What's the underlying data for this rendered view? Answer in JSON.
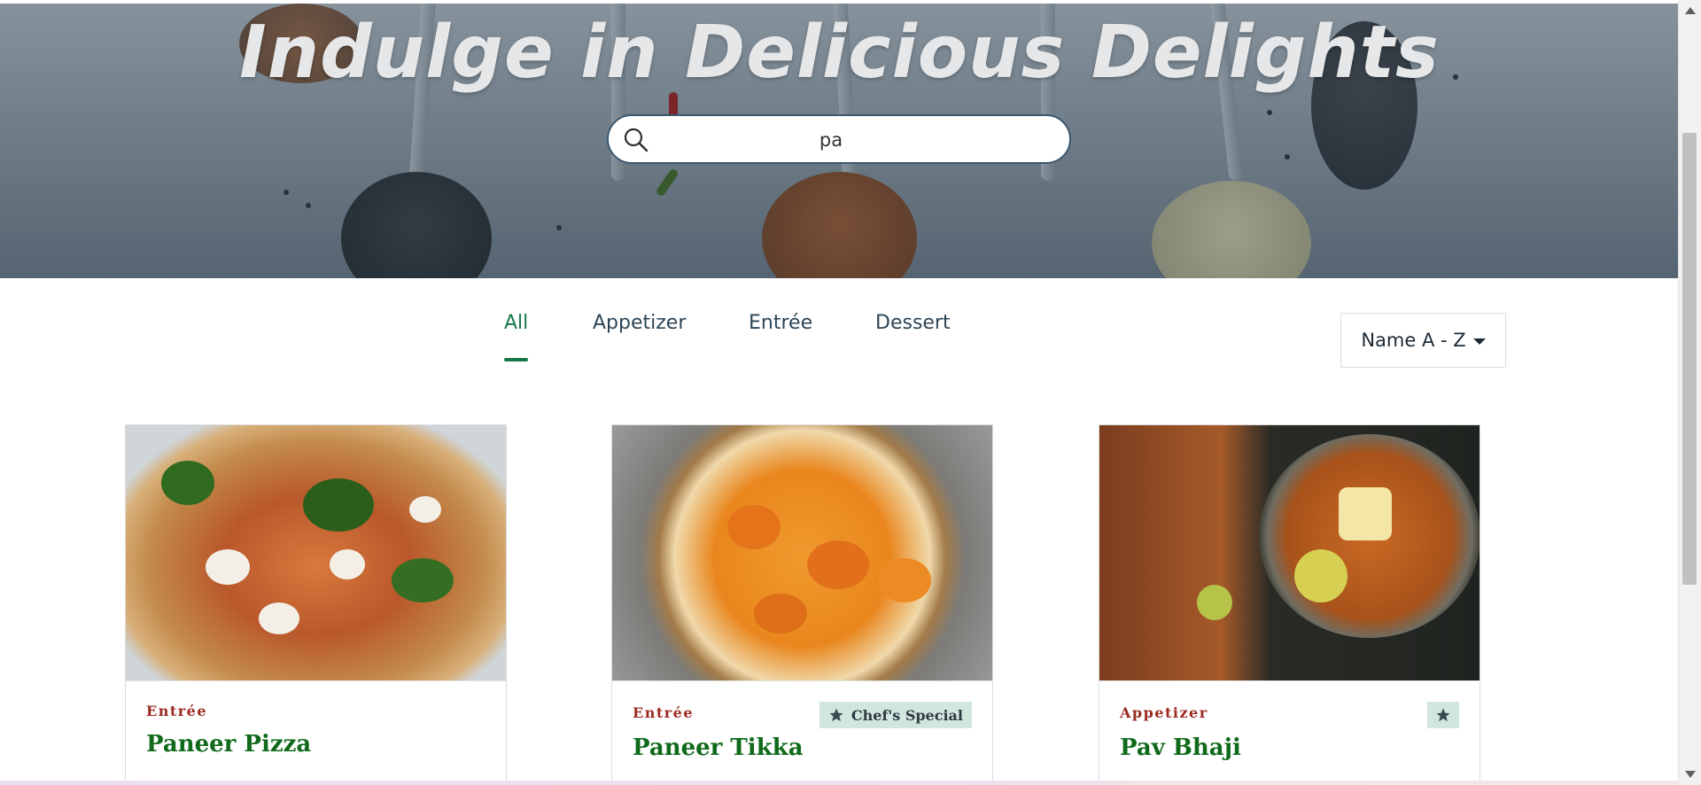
{
  "hero": {
    "title": "Indulge in Delicious Delights",
    "search": {
      "value": "pa",
      "placeholder": ""
    }
  },
  "tabs": [
    {
      "label": "All",
      "active": true
    },
    {
      "label": "Appetizer",
      "active": false
    },
    {
      "label": "Entrée",
      "active": false
    },
    {
      "label": "Dessert",
      "active": false
    }
  ],
  "sort": {
    "label": "Name A - Z"
  },
  "cards": [
    {
      "category": "Entrée",
      "name": "Paneer Pizza",
      "badge": ""
    },
    {
      "category": "Entrée",
      "name": "Paneer Tikka",
      "badge": "Chef's Special"
    },
    {
      "category": "Appetizer",
      "name": "Pav Bhaji",
      "badge": ""
    }
  ],
  "colors": {
    "accent_green": "#16784a",
    "dish_name": "#0f6a1a",
    "category_red": "#9c2a22",
    "badge_bg": "#d2e6e0"
  },
  "icons": [
    "search-icon",
    "star-icon",
    "caret-down-icon"
  ]
}
